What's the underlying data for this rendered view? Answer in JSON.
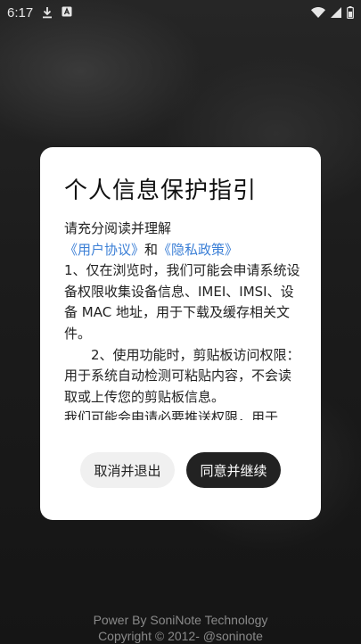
{
  "status_bar": {
    "time": "6:17",
    "icons": [
      "download-icon",
      "notification-a-icon",
      "wifi-icon",
      "signal-icon",
      "battery-icon"
    ]
  },
  "dialog": {
    "title": "个人信息保护指引",
    "intro": "请充分阅读并理解",
    "user_agreement": "《用户协议》",
    "and": "和",
    "privacy_policy": "《隐私政策》",
    "para1": "1、仅在浏览时，我们可能会申请系统设备权限收集设备信息、IMEI、IMSI、设备 MAC 地址，用于下载及缓存相关文件。",
    "para2": "2、使用功能时，剪贴板访问权限：用于系统自动检测可粘贴内容，不会读取或上传您的剪贴板信息。",
    "para3": "我们可能会申请必要推送权限，用于",
    "cancel_label": "取消并退出",
    "agree_label": "同意并继续"
  },
  "footer": {
    "line1": "Power By SoniNote Technology",
    "line2": "Copyright © 2012-  @soninote"
  },
  "colors": {
    "link": "#3b7fd6",
    "agree_button": "#222222",
    "cancel_button": "#f0f0f0"
  }
}
